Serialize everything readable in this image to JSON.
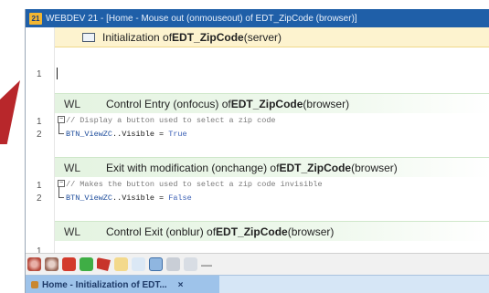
{
  "window": {
    "app_badge": "21",
    "title": "WEBDEV 21 - [Home - Mouse out (onmouseout) of EDT_ZipCode (browser)]"
  },
  "editor": {
    "server_section": {
      "label": "Initialization of ",
      "field": "EDT_ZipCode",
      "suffix": " (server)",
      "line_numbers": [
        "1"
      ]
    },
    "sections": [
      {
        "kind": "WL",
        "event": "Control Entry (onfocus) of ",
        "field": "EDT_ZipCode",
        "suffix": " (browser)",
        "lines": [
          {
            "no": "1",
            "text": "// Display a button used to select a zip code",
            "type": "comment"
          },
          {
            "no": "2",
            "ident": "BTN_ViewZC",
            "mid": "..Visible = ",
            "value": "True"
          }
        ]
      },
      {
        "kind": "WL",
        "event": "Exit with modification (onchange) of ",
        "field": "EDT_ZipCode",
        "suffix": " (browser)",
        "lines": [
          {
            "no": "1",
            "text": "// Makes the button used to select a zip code invisible",
            "type": "comment"
          },
          {
            "no": "2",
            "ident": "BTN_ViewZC",
            "mid": "..Visible = ",
            "value": "False"
          }
        ]
      },
      {
        "kind": "WL",
        "event": "Control Exit (onblur) of ",
        "field": "EDT_ZipCode",
        "suffix": " (browser)",
        "lines": [
          {
            "no": "1"
          }
        ]
      }
    ]
  },
  "toolbar": {
    "icons": [
      "gear-red-icon",
      "gear-icon",
      "red-block-icon",
      "green-block-icon",
      "red-shape-icon",
      "yellow-icon",
      "lightblue-icon",
      "selected-blue-icon",
      "grey-icon",
      "pointer-icon"
    ],
    "separator": "—"
  },
  "tabbar": {
    "active_tab": "Home - Initialization of EDT...",
    "close": "×"
  }
}
